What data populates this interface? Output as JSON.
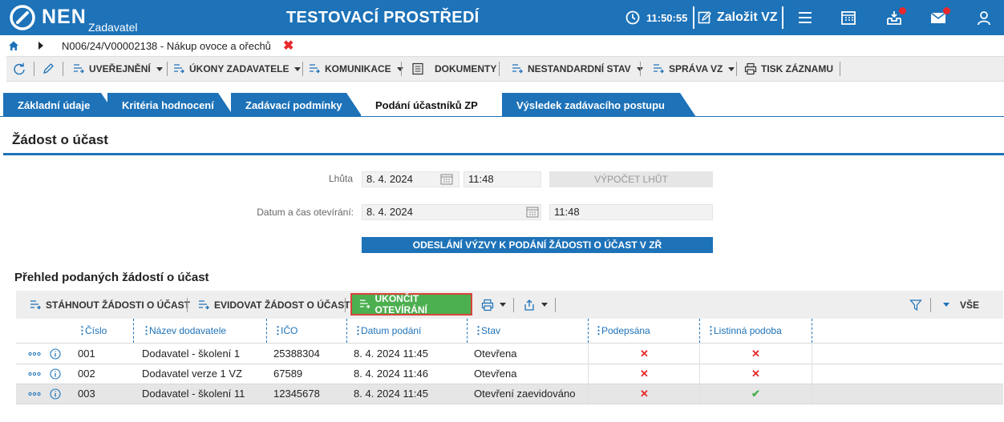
{
  "header": {
    "logo_text": "NEN",
    "logo_sub": "Zadavatel",
    "env_title": "TESTOVACÍ PROSTŘEDÍ",
    "time": "11:50:55",
    "create_vz": "Založit VZ",
    "icons": [
      "menu-icon",
      "calendar-icon",
      "inbox-icon",
      "mail-icon",
      "user-icon"
    ]
  },
  "breadcrumb": {
    "path": "N006/24/V00002138 - Nákup ovoce a ořechů",
    "close": "✖"
  },
  "toolbar": {
    "uverejneni": "UVEŘEJNĚNÍ",
    "ukony": "ÚKONY ZADAVATELE",
    "komunikace": "KOMUNIKACE",
    "dokumenty": "DOKUMENTY",
    "nestandardni": "NESTANDARDNÍ STAV",
    "sprava": "SPRÁVA VZ",
    "tisk": "TISK ZÁZNAMU"
  },
  "tabs": [
    {
      "label": "Základní údaje"
    },
    {
      "label": "Kritéria hodnocení"
    },
    {
      "label": "Zadávací podmínky"
    },
    {
      "label": "Podání účastníků ZP"
    },
    {
      "label": "Výsledek zadávacího postupu"
    }
  ],
  "section": {
    "title": "Žádost o účast"
  },
  "form": {
    "lhuta_label": "Lhůta",
    "lhuta_date": "8. 4. 2024",
    "lhuta_time": "11:48",
    "vypocet_button": "VÝPOČET LHŮT",
    "otevirani_label": "Datum a čas otevírání:",
    "otevirani_date": "8. 4. 2024",
    "otevirani_time": "11:48",
    "odeslani_button": "ODESLÁNÍ VÝZVY K PODÁNÍ ŽÁDOSTI O ÚČAST V ZŘ"
  },
  "grid": {
    "title": "Přehled podaných žádostí o účast",
    "toolbar": {
      "stahnout": "STÁHNOUT ŽÁDOSTI O ÚČAST",
      "evidovat": "EVIDOVAT ŽÁDOST O ÚČAST",
      "ukoncit": "UKONČIT OTEVÍRÁNÍ",
      "vse": "VŠE"
    },
    "columns": [
      "Číslo",
      "Název dodavatele",
      "IČO",
      "Datum podání",
      "Stav",
      "Podepsána",
      "Listinná podoba"
    ],
    "rows": [
      {
        "cislo": "001",
        "nazev": "Dodavatel - školení 1",
        "ico": "25388304",
        "datum": "8. 4. 2024 11:45",
        "stav": "Otevřena",
        "podepsana": "✕",
        "listinna": "✕"
      },
      {
        "cislo": "002",
        "nazev": "Dodavatel verze 1 VZ",
        "ico": "67589",
        "datum": "8. 4. 2024 11:46",
        "stav": "Otevřena",
        "podepsana": "✕",
        "listinna": "✕"
      },
      {
        "cislo": "003",
        "nazev": "Dodavatel - školení 11",
        "ico": "12345678",
        "datum": "8. 4. 2024 11:45",
        "stav": "Otevření zaevidováno",
        "podepsana": "✕",
        "listinna": "✔"
      }
    ]
  },
  "colors": {
    "primary": "#1d72b8",
    "green": "#4caf50",
    "red": "#e8292b"
  }
}
